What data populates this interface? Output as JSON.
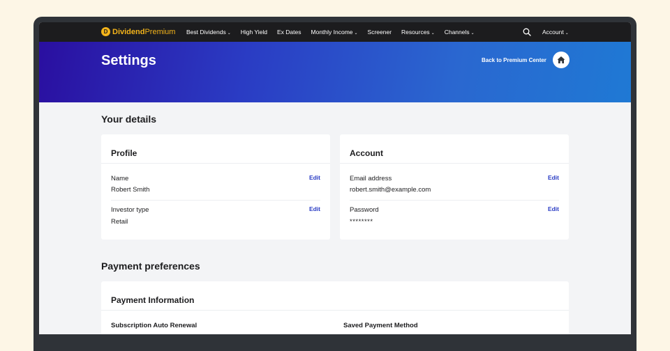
{
  "nav": {
    "logo_mark": "D",
    "logo_bold": "Dividend",
    "logo_light": "Premium",
    "items": [
      {
        "label": "Best Dividends",
        "dropdown": true
      },
      {
        "label": "High Yield",
        "dropdown": false
      },
      {
        "label": "Ex Dates",
        "dropdown": false
      },
      {
        "label": "Monthly Income",
        "dropdown": true
      },
      {
        "label": "Screener",
        "dropdown": false
      },
      {
        "label": "Resources",
        "dropdown": true
      },
      {
        "label": "Channels",
        "dropdown": true
      }
    ],
    "account_label": "Account",
    "dropdown_glyph": "⌄"
  },
  "hero": {
    "title": "Settings",
    "back_label": "Back to Premium Center"
  },
  "details": {
    "heading": "Your details",
    "profile": {
      "title": "Profile",
      "name_label": "Name",
      "name_value": "Robert Smith",
      "investor_label": "Investor type",
      "investor_value": "Retail",
      "edit_label": "Edit"
    },
    "account": {
      "title": "Account",
      "email_label": "Email address",
      "email_value": "robert.smith@example.com",
      "password_label": "Password",
      "password_value": "********",
      "edit_label": "Edit"
    }
  },
  "payment": {
    "heading": "Payment preferences",
    "card_title": "Payment Information",
    "auto_renewal_label": "Subscription Auto Renewal",
    "saved_method_label": "Saved Payment Method"
  },
  "colors": {
    "accent": "#2a3cc4",
    "brand": "#f4b41a",
    "nav_bg": "#1c1c1e"
  }
}
